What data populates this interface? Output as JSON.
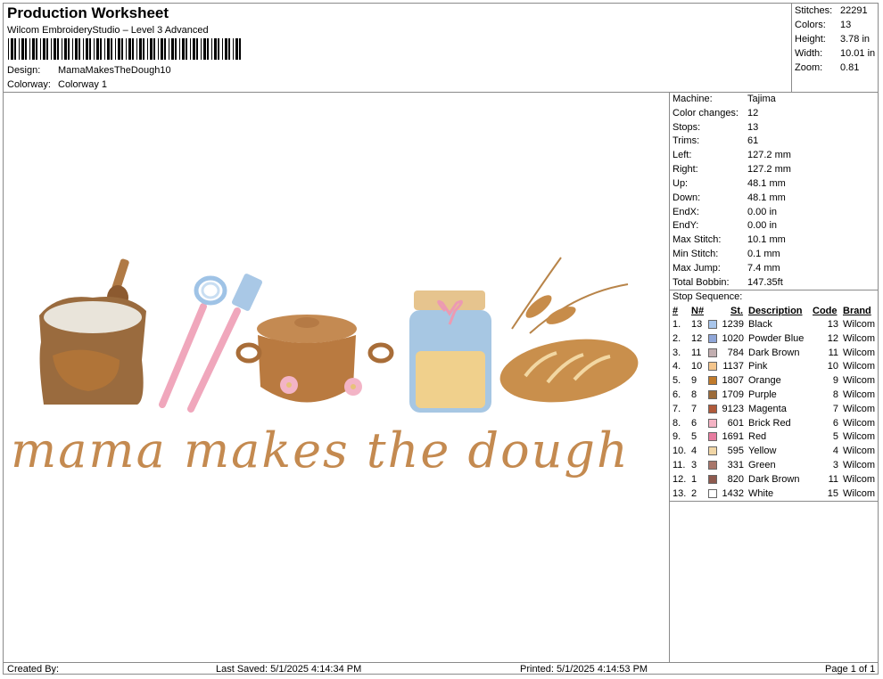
{
  "header": {
    "title": "Production Worksheet",
    "subtitle": "Wilcom EmbroideryStudio – Level 3 Advanced",
    "design_label": "Design:",
    "design_value": "MamaMakesTheDough10",
    "colorway_label": "Colorway:",
    "colorway_value": "Colorway 1"
  },
  "stats": [
    {
      "label": "Stitches:",
      "value": "22291"
    },
    {
      "label": "Colors:",
      "value": "13"
    },
    {
      "label": "Height:",
      "value": "3.78 in"
    },
    {
      "label": "Width:",
      "value": "10.01 in"
    },
    {
      "label": "Zoom:",
      "value": "0.81"
    }
  ],
  "machine": [
    {
      "label": "Machine:",
      "value": "Tajima"
    },
    {
      "label": "Color changes:",
      "value": "12"
    },
    {
      "label": "Stops:",
      "value": "13"
    },
    {
      "label": "Trims:",
      "value": "61"
    },
    {
      "label": "Left:",
      "value": "127.2 mm"
    },
    {
      "label": "Right:",
      "value": "127.2 mm"
    },
    {
      "label": "Up:",
      "value": "48.1 mm"
    },
    {
      "label": "Down:",
      "value": "48.1 mm"
    },
    {
      "label": "EndX:",
      "value": "0.00 in"
    },
    {
      "label": "EndY:",
      "value": "0.00 in"
    },
    {
      "label": "Max Stitch:",
      "value": "10.1 mm"
    },
    {
      "label": "Min Stitch:",
      "value": "0.1 mm"
    },
    {
      "label": "Max Jump:",
      "value": "7.4 mm"
    },
    {
      "label": "Total Bobbin:",
      "value": "147.35ft"
    }
  ],
  "stop_sequence": {
    "title": "Stop Sequence:",
    "columns": {
      "num": "#",
      "n": "N#",
      "st": "St.",
      "description": "Description",
      "code": "Code",
      "brand": "Brand"
    },
    "rows": [
      {
        "num": "1.",
        "n": "13",
        "color": "#a9c6ec",
        "st": "1239",
        "description": "Black",
        "code": "13",
        "brand": "Wilcom"
      },
      {
        "num": "2.",
        "n": "12",
        "color": "#8fa6d8",
        "st": "1020",
        "description": "Powder Blue",
        "code": "12",
        "brand": "Wilcom"
      },
      {
        "num": "3.",
        "n": "11",
        "color": "#c2aeb0",
        "st": "784",
        "description": "Dark Brown",
        "code": "11",
        "brand": "Wilcom"
      },
      {
        "num": "4.",
        "n": "10",
        "color": "#f4c58c",
        "st": "1137",
        "description": "Pink",
        "code": "10",
        "brand": "Wilcom"
      },
      {
        "num": "5.",
        "n": "9",
        "color": "#c07a2a",
        "st": "1807",
        "description": "Orange",
        "code": "9",
        "brand": "Wilcom"
      },
      {
        "num": "6.",
        "n": "8",
        "color": "#9c6b3a",
        "st": "1709",
        "description": "Purple",
        "code": "8",
        "brand": "Wilcom"
      },
      {
        "num": "7.",
        "n": "7",
        "color": "#b05a3a",
        "st": "9123",
        "description": "Magenta",
        "code": "7",
        "brand": "Wilcom"
      },
      {
        "num": "8.",
        "n": "6",
        "color": "#f4b3c4",
        "st": "601",
        "description": "Brick Red",
        "code": "6",
        "brand": "Wilcom"
      },
      {
        "num": "9.",
        "n": "5",
        "color": "#e77ca0",
        "st": "1691",
        "description": "Red",
        "code": "5",
        "brand": "Wilcom"
      },
      {
        "num": "10.",
        "n": "4",
        "color": "#f1d6a6",
        "st": "595",
        "description": "Yellow",
        "code": "4",
        "brand": "Wilcom"
      },
      {
        "num": "11.",
        "n": "3",
        "color": "#a8766a",
        "st": "331",
        "description": "Green",
        "code": "3",
        "brand": "Wilcom"
      },
      {
        "num": "12.",
        "n": "1",
        "color": "#8e5a4e",
        "st": "820",
        "description": "Dark Brown",
        "code": "11",
        "brand": "Wilcom"
      },
      {
        "num": "13.",
        "n": "2",
        "color": "#ffffff",
        "st": "1432",
        "description": "White",
        "code": "15",
        "brand": "Wilcom"
      }
    ]
  },
  "design_text": "mama makes the dough",
  "footer": {
    "created_by": "Created By:",
    "last_saved": "Last Saved: 5/1/2025 4:14:34 PM",
    "printed": "Printed: 5/1/2025 4:14:53 PM",
    "page": "Page 1 of 1"
  }
}
